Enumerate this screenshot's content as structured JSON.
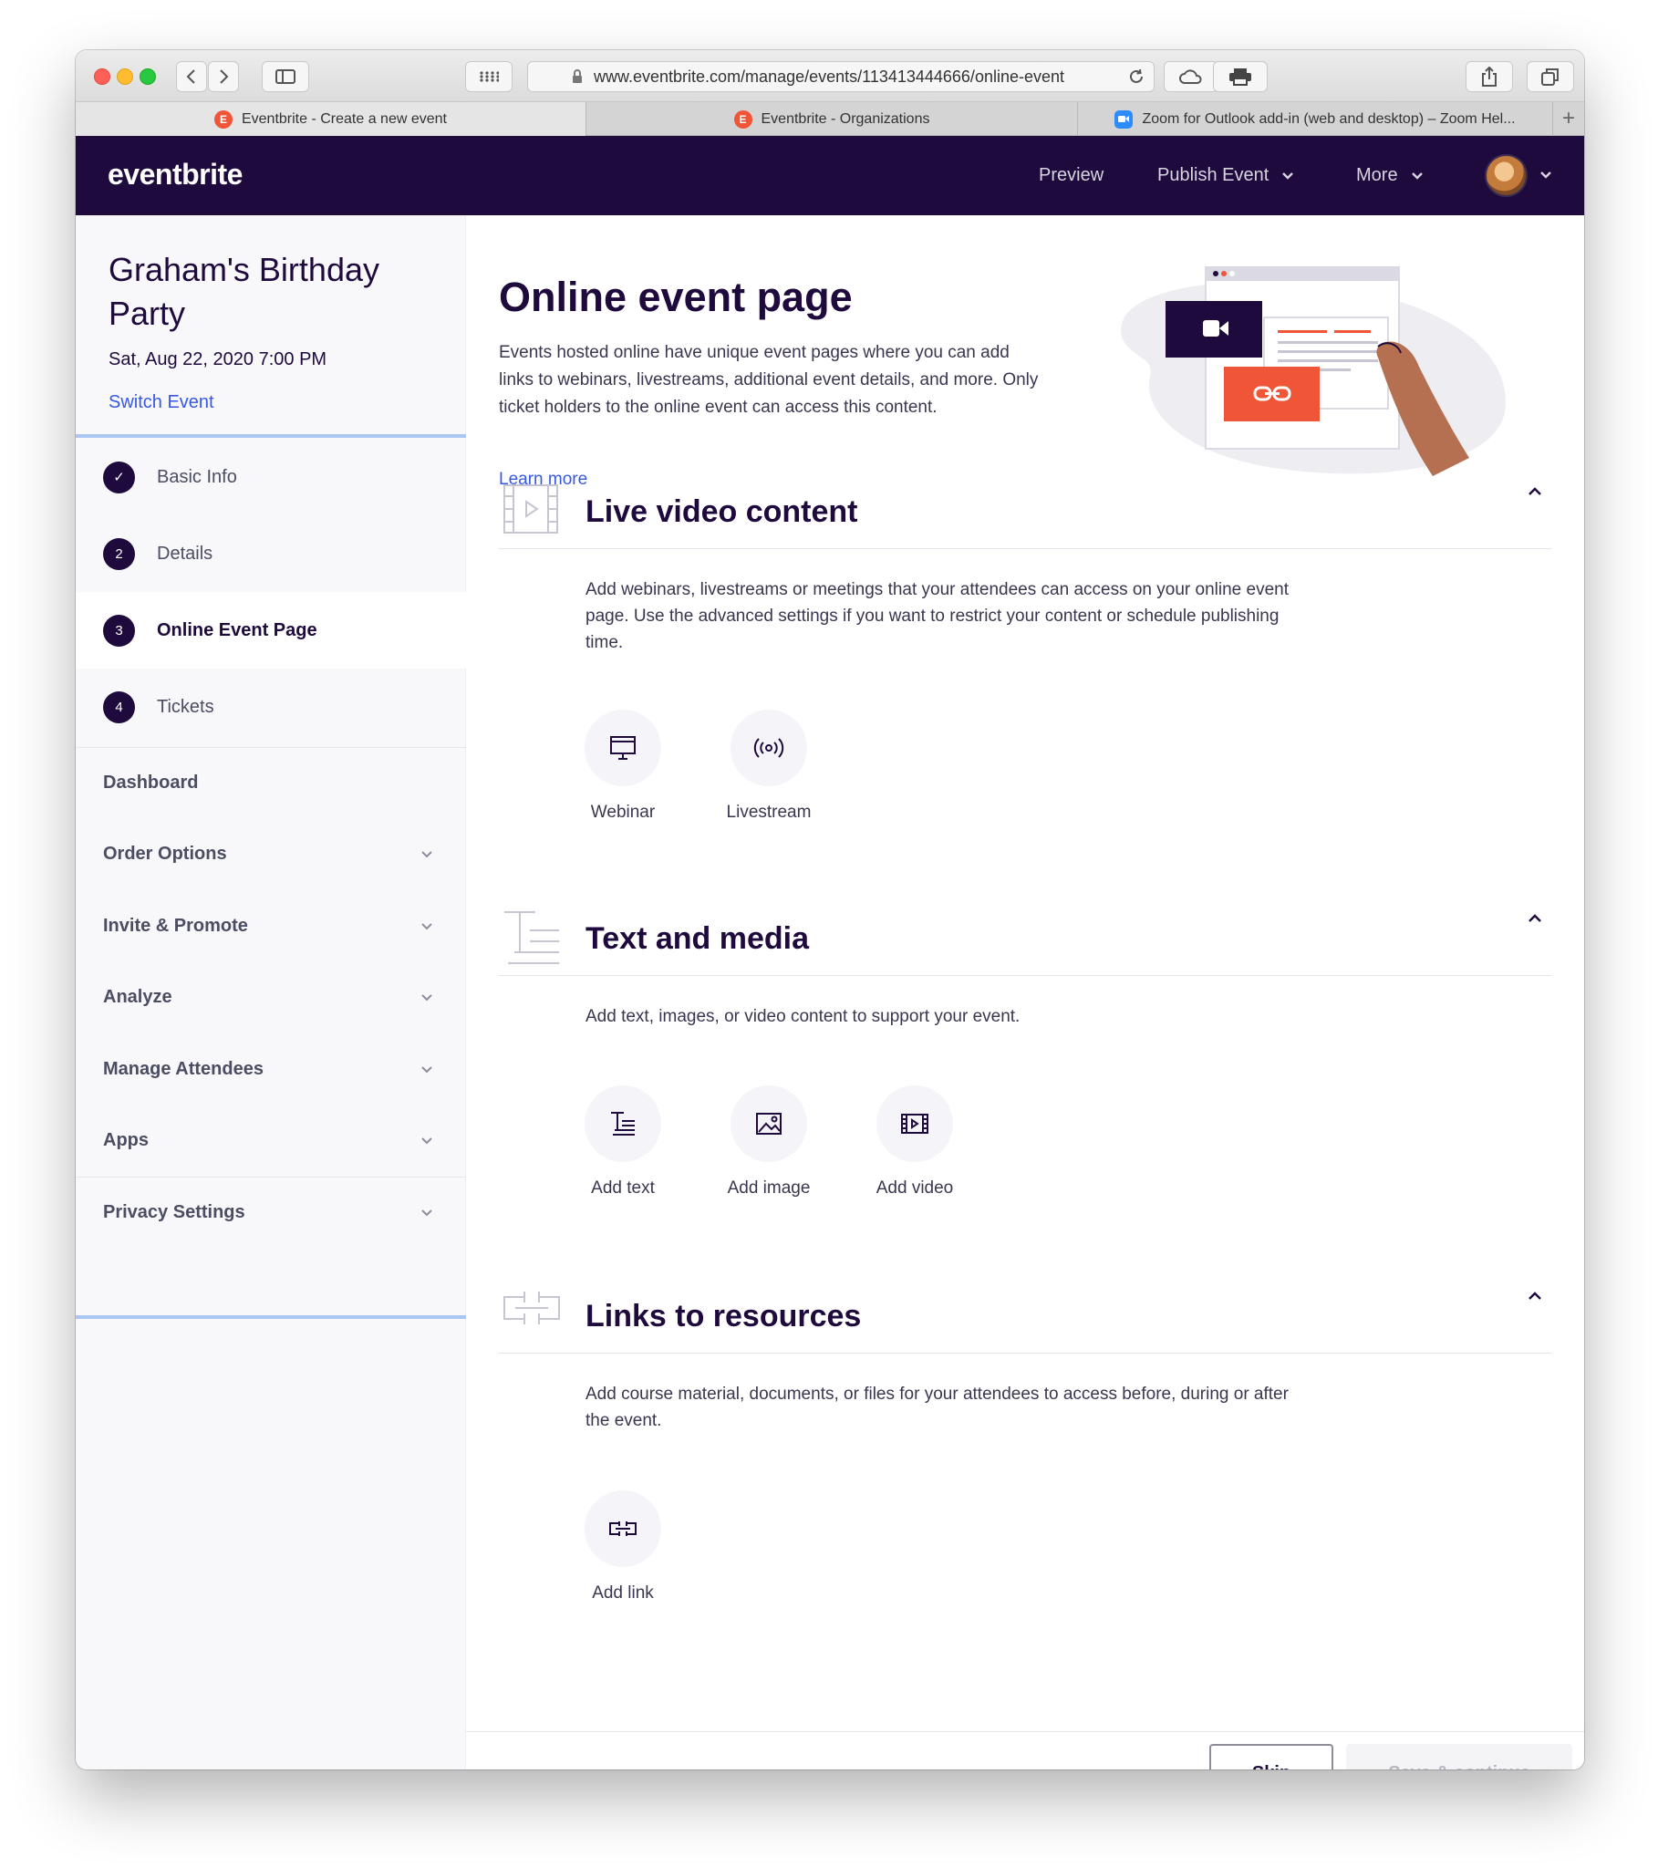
{
  "browser": {
    "url": "www.eventbrite.com/manage/events/113413444666/online-event",
    "tabs": [
      {
        "label": "Eventbrite - Create a new event",
        "favicon": "E"
      },
      {
        "label": "Eventbrite - Organizations",
        "favicon": "E"
      },
      {
        "label": "Zoom for Outlook add-in (web and desktop) – Zoom Hel...",
        "favicon": "zoom-icon"
      }
    ]
  },
  "topnav": {
    "brand": "eventbrite",
    "preview": "Preview",
    "publish": "Publish Event",
    "more": "More"
  },
  "event": {
    "title": "Graham's Birthday Party",
    "date": "Sat, Aug 22, 2020 7:00 PM",
    "switch_label": "Switch Event"
  },
  "steps": [
    {
      "num": "✓",
      "label": "Basic Info"
    },
    {
      "num": "2",
      "label": "Details"
    },
    {
      "num": "3",
      "label": "Online Event Page"
    },
    {
      "num": "4",
      "label": "Tickets"
    }
  ],
  "menu": [
    {
      "label": "Dashboard"
    },
    {
      "label": "Order Options"
    },
    {
      "label": "Invite & Promote"
    },
    {
      "label": "Analyze"
    },
    {
      "label": "Manage Attendees"
    },
    {
      "label": "Apps"
    },
    {
      "label": "Privacy Settings"
    }
  ],
  "page": {
    "title": "Online event page",
    "description": "Events hosted online have unique event pages where you can add links to webinars, livestreams, additional event details, and more. Only ticket holders to the online event can access this content.",
    "learn_more": "Learn more"
  },
  "sections": {
    "live": {
      "title": "Live video content",
      "description": "Add webinars, livestreams or meetings that your attendees can access on your online event page. Use the advanced settings if you want to restrict your content or schedule publishing time.",
      "options": [
        "Webinar",
        "Livestream"
      ]
    },
    "text": {
      "title": "Text and media",
      "description": "Add text, images, or video content to support your event.",
      "options": [
        "Add text",
        "Add image",
        "Add video"
      ]
    },
    "links": {
      "title": "Links to resources",
      "description": "Add course material, documents, or files for your attendees to access before, during or after the event.",
      "options": [
        "Add link"
      ]
    }
  },
  "footer": {
    "skip": "Skip",
    "save": "Save & continue"
  },
  "colors": {
    "nav_bg": "#1e0a3c",
    "link": "#3659e3",
    "accent_red": "#f05537",
    "sidebar_rule": "#a9c7f0"
  }
}
